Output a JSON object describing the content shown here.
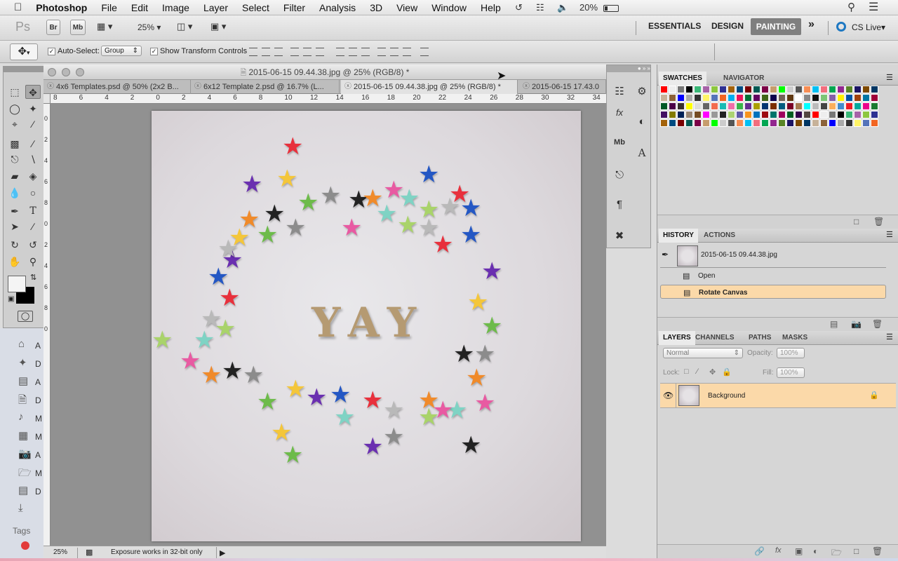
{
  "menubar": {
    "apple": "",
    "app": "Photoshop",
    "items": [
      "File",
      "Edit",
      "Image",
      "Layer",
      "Select",
      "Filter",
      "Analysis",
      "3D",
      "View",
      "Window",
      "Help"
    ],
    "battery": "20%"
  },
  "appbar": {
    "ps_logo": "Ps",
    "br": "Br",
    "mb": "Mb",
    "zoom": "25%",
    "workspaces": [
      "ESSENTIALS",
      "DESIGN",
      "PAINTING"
    ],
    "active_workspace": "PAINTING",
    "more": "»",
    "cslive": "CS Live"
  },
  "options": {
    "auto_select_label": "Auto-Select:",
    "auto_select_value": "Group",
    "transform_label": "Show Transform Controls"
  },
  "document": {
    "window_title": "2015-06-15 09.44.38.jpg @ 25% (RGB/8) *",
    "tabs": [
      "4x6 Templates.psd @ 50% (2x2 B...",
      "6x12 Template 2.psd @ 16.7% (L...",
      "2015-06-15 09.44.38.jpg @ 25% (RGB/8) *",
      "2015-06-15 17.43.0"
    ],
    "ruler_h": [
      "8",
      "6",
      "4",
      "2",
      "0",
      "2",
      "4",
      "6",
      "8",
      "10",
      "12",
      "14",
      "16",
      "18",
      "20",
      "22",
      "24",
      "26",
      "28",
      "30",
      "32",
      "34"
    ],
    "ruler_v": [
      "0",
      "2",
      "4",
      "6",
      "8",
      "0",
      "2",
      "4",
      "6",
      "8",
      "0"
    ],
    "photo_text": "YAY",
    "status_zoom": "25%",
    "status_message": "Exposure works in 32-bit only"
  },
  "panels": {
    "swatch_tabs": [
      "SWATCHES",
      "NAVIGATOR"
    ],
    "history_tabs": [
      "HISTORY",
      "ACTIONS"
    ],
    "history_snapshot": "2015-06-15 09.44.38.jpg",
    "history_items": [
      "Open",
      "Rotate Canvas"
    ],
    "layers_tabs": [
      "LAYERS",
      "CHANNELS",
      "PATHS",
      "MASKS"
    ],
    "blend_mode": "Normal",
    "opacity_label": "Opacity:",
    "opacity_value": "100%",
    "lock_label": "Lock:",
    "fill_label": "Fill:",
    "fill_value": "100%",
    "layer_name": "Background"
  },
  "sidebar": {
    "items": [
      "A",
      "D",
      "A",
      "D",
      "M",
      "M",
      "A",
      "M",
      "D"
    ],
    "tags_label": "Tags"
  },
  "colors": {
    "accent_selection": "#fbd9a9",
    "active_tab": "#e2e2e2"
  }
}
